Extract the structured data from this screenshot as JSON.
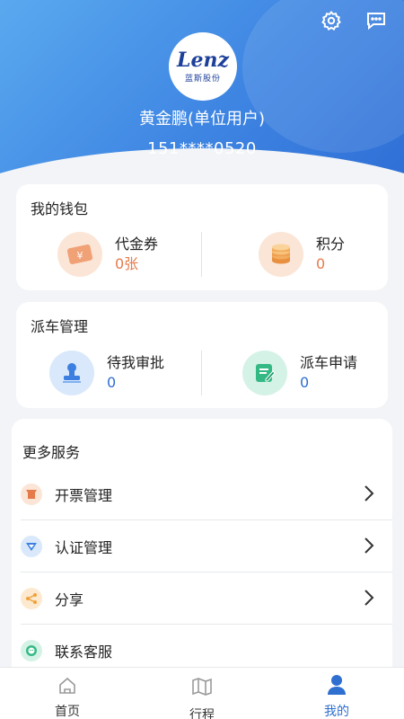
{
  "header": {
    "logo_text": "Lenz",
    "logo_subtitle": "蓝斯股份",
    "user_name": "黄金鹏(单位用户)",
    "user_phone": "151****0520",
    "icons": [
      "gear-icon",
      "message-icon"
    ]
  },
  "wallet": {
    "title": "我的钱包",
    "items": [
      {
        "label": "代金券",
        "value": "0张",
        "icon": "ticket-icon",
        "color": "#e57a4b"
      },
      {
        "label": "积分",
        "value": "0",
        "icon": "coins-icon",
        "color": "#e57a4b"
      }
    ]
  },
  "dispatch": {
    "title": "派车管理",
    "items": [
      {
        "label": "待我审批",
        "value": "0",
        "icon": "stamp-icon",
        "color": "#2e6fd0"
      },
      {
        "label": "派车申请",
        "value": "0",
        "icon": "form-icon",
        "color": "#2e6fd0"
      }
    ]
  },
  "services": {
    "title": "更多服务",
    "items": [
      {
        "label": "开票管理",
        "icon": "invoice-icon"
      },
      {
        "label": "认证管理",
        "icon": "verify-icon"
      },
      {
        "label": "分享",
        "icon": "share-icon"
      },
      {
        "label": "联系客服",
        "icon": "customer-service-icon"
      }
    ]
  },
  "tabbar": {
    "tabs": [
      {
        "label": "首页",
        "icon": "home-icon",
        "active": false
      },
      {
        "label": "行程",
        "icon": "map-icon",
        "active": false
      },
      {
        "label": "我的",
        "icon": "user-icon",
        "active": true
      }
    ],
    "active_color": "#2e6fd0",
    "inactive_color": "#333333"
  }
}
